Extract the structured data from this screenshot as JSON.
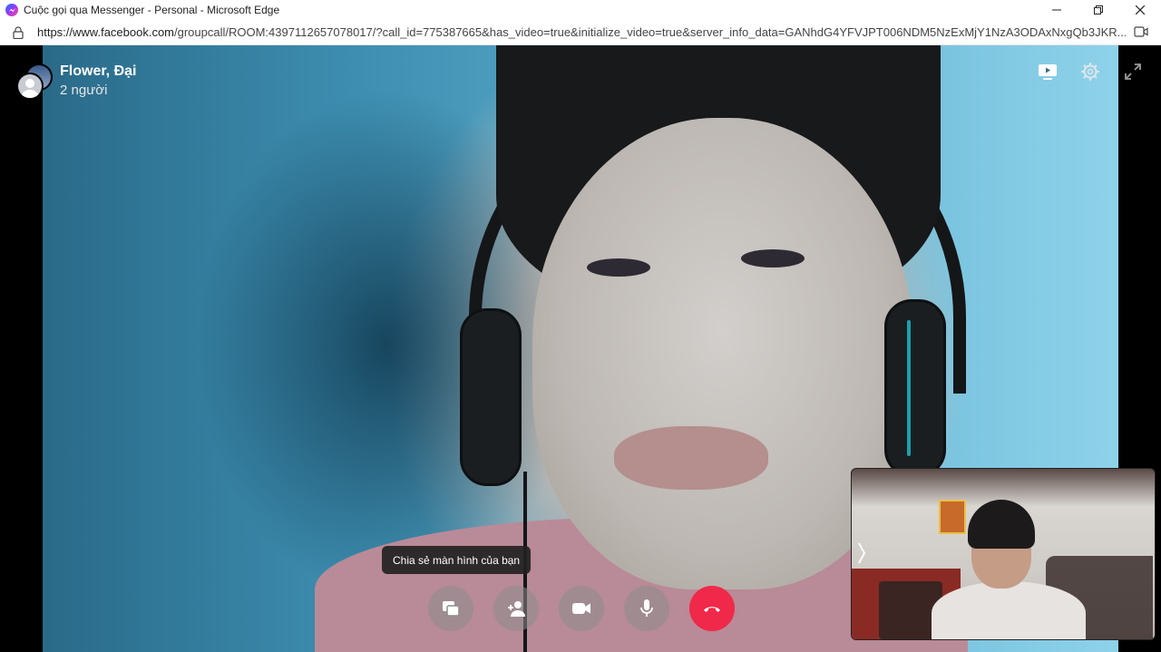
{
  "window": {
    "title": "Cuộc gọi qua Messenger - Personal - Microsoft Edge",
    "minimize_label": "–"
  },
  "addressbar": {
    "url_host": "https://www.facebook.com",
    "url_rest": "/groupcall/ROOM:4397112657078017/?call_id=775387665&has_video=true&initialize_video=true&server_info_data=GANhdG4YFVJPT006NDM5NzExMjY1NzA3ODAxNxgQb3JKR..."
  },
  "call": {
    "name": "Flower, Đại",
    "participants": "2 người"
  },
  "tooltip": {
    "text": "Chia sẻ màn hình của bạn"
  },
  "controls": [
    {
      "name": "share-screen",
      "icon": "share-screen-icon"
    },
    {
      "name": "add-person",
      "icon": "add-person-icon"
    },
    {
      "name": "camera",
      "icon": "video-camera-icon"
    },
    {
      "name": "microphone",
      "icon": "microphone-icon"
    },
    {
      "name": "end-call",
      "icon": "end-call-icon",
      "color": "#f02849"
    }
  ],
  "colors": {
    "end_call": "#f02849",
    "titlebar_bg": "#ffffff",
    "stage_bg": "#000000"
  }
}
